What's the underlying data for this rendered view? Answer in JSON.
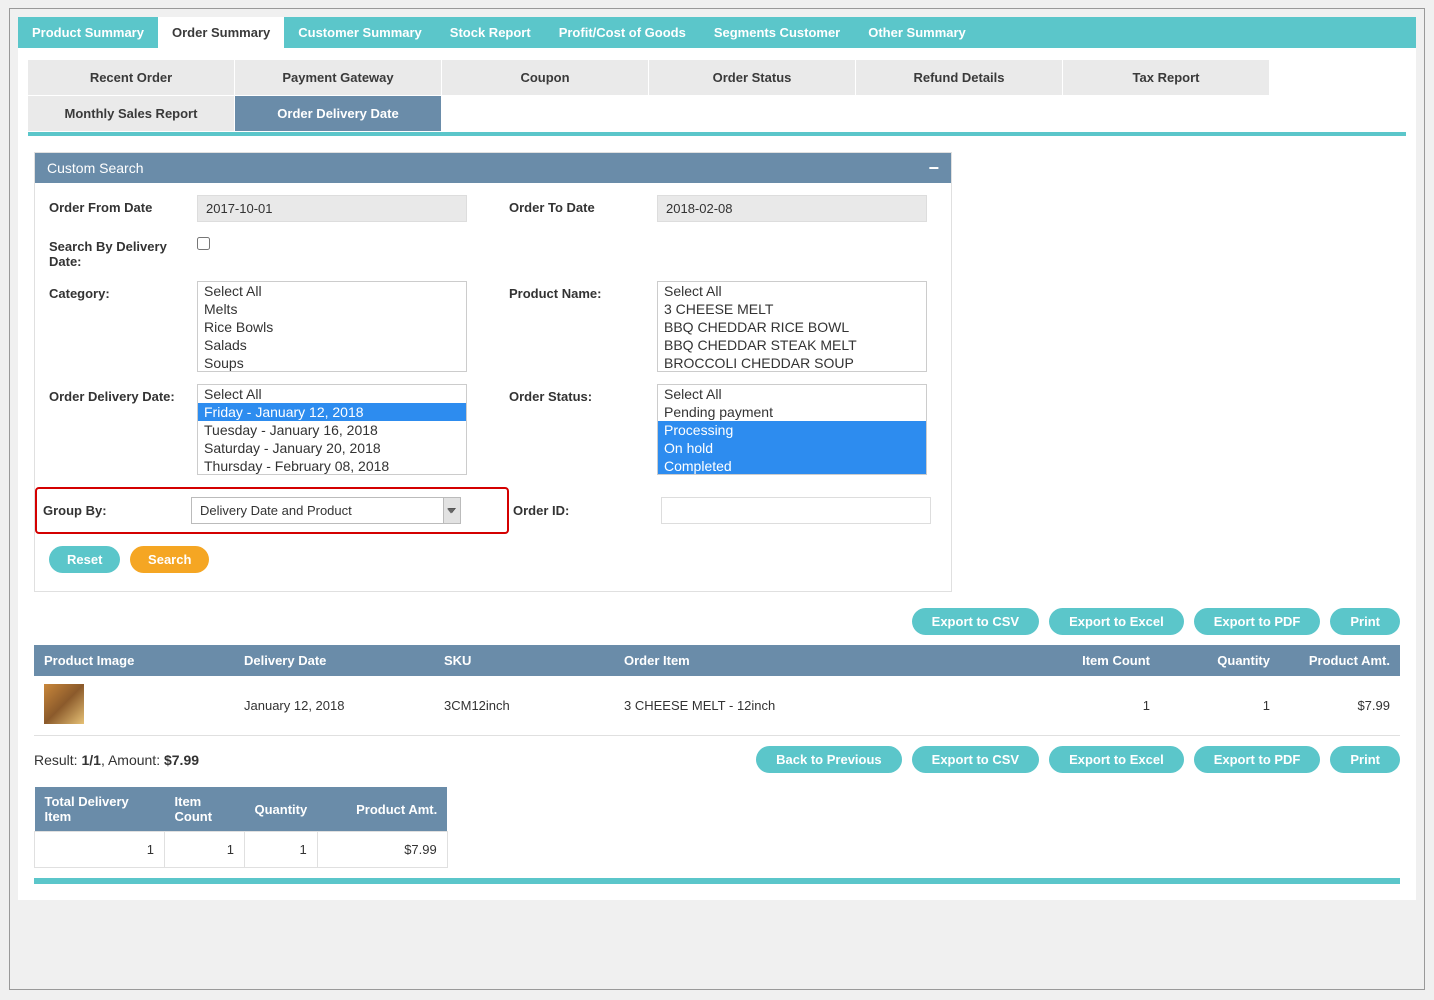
{
  "topTabs": [
    "Product Summary",
    "Order Summary",
    "Customer Summary",
    "Stock Report",
    "Profit/Cost of Goods",
    "Segments Customer",
    "Other Summary"
  ],
  "topTabActive": 1,
  "subTabs": [
    "Recent Order",
    "Payment Gateway",
    "Coupon",
    "Order Status",
    "Refund Details",
    "Tax Report",
    "Monthly Sales Report",
    "Order Delivery Date"
  ],
  "subTabActive": 7,
  "panel": {
    "title": "Custom Search",
    "collapseGlyph": "−"
  },
  "form": {
    "orderFromDateLabel": "Order From Date",
    "orderFromDate": "2017-10-01",
    "orderToDateLabel": "Order To Date",
    "orderToDate": "2018-02-08",
    "searchByDeliveryDateLabel": "Search By Delivery Date:",
    "categoryLabel": "Category:",
    "categoryItems": [
      "Select All",
      "Melts",
      "Rice Bowls",
      "Salads",
      "Soups"
    ],
    "productNameLabel": "Product Name:",
    "productItems": [
      "Select All",
      "3 CHEESE MELT",
      "BBQ CHEDDAR RICE BOWL",
      "BBQ CHEDDAR STEAK MELT",
      "BROCCOLI CHEDDAR SOUP"
    ],
    "deliveryDateLabel": "Order Delivery Date:",
    "deliveryItems": [
      "Select All",
      "Friday - January 12, 2018",
      "Tuesday - January 16, 2018",
      "Saturday - January 20, 2018",
      "Thursday - February 08, 2018"
    ],
    "deliverySelected": [
      1
    ],
    "orderStatusLabel": "Order Status:",
    "statusItems": [
      "Select All",
      "Pending payment",
      "Processing",
      "On hold",
      "Completed"
    ],
    "statusSelected": [
      2,
      3,
      4
    ],
    "groupByLabel": "Group By:",
    "groupByValue": "Delivery Date and Product",
    "orderIdLabel": "Order ID:",
    "orderIdValue": ""
  },
  "buttons": {
    "reset": "Reset",
    "search": "Search"
  },
  "export": {
    "csv": "Export to CSV",
    "excel": "Export to Excel",
    "pdf": "Export to PDF",
    "print": "Print",
    "back": "Back to Previous"
  },
  "table": {
    "headers": [
      "Product Image",
      "Delivery Date",
      "SKU",
      "Order Item",
      "Item Count",
      "Quantity",
      "Product Amt."
    ],
    "rows": [
      {
        "productImage": "thumb",
        "deliveryDate": "January 12, 2018",
        "sku": "3CM12inch",
        "orderItem": "3 CHEESE MELT - 12inch",
        "itemCount": "1",
        "quantity": "1",
        "productAmt": "$7.99"
      }
    ]
  },
  "resultLine": {
    "prefix": "Result: ",
    "count": "1/1",
    "amountPrefix": ", Amount: ",
    "amount": "$7.99"
  },
  "summary": {
    "headers": [
      "Total Delivery Item",
      "Item Count",
      "Quantity",
      "Product Amt."
    ],
    "row": {
      "totalDeliveryItem": "1",
      "itemCount": "1",
      "quantity": "1",
      "productAmt": "$7.99"
    }
  }
}
